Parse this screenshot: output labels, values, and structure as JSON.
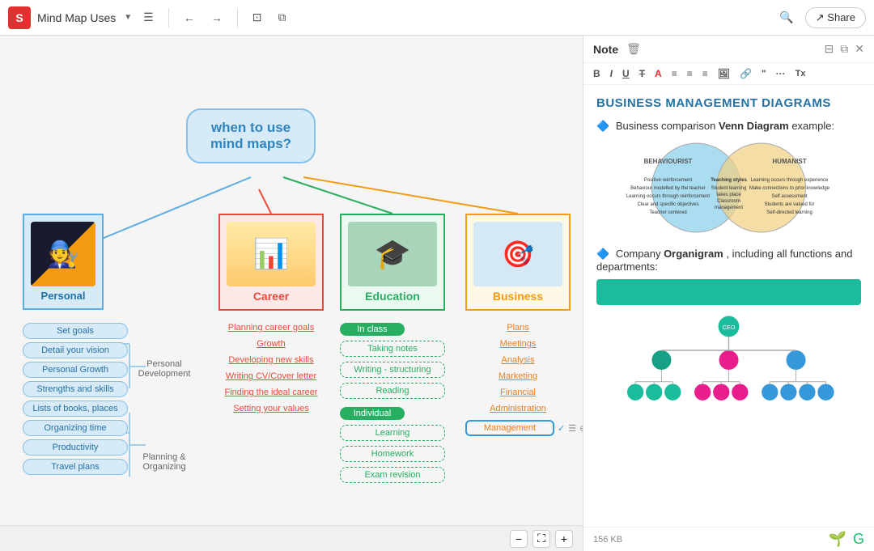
{
  "toolbar": {
    "logo": "S",
    "title": "Mind Map Uses",
    "undo_label": "←",
    "redo_label": "→",
    "search_label": "🔍",
    "share_label": "Share"
  },
  "mindmap": {
    "center_text": "when to use\nmind maps?",
    "personal": {
      "label": "Personal",
      "emoji": "👤",
      "sub_items": [
        "Set goals",
        "Detail your vision",
        "Personal Growth",
        "Strengths and skills",
        "Lists of books, places",
        "Organizing time",
        "Productivity",
        "Travel plans"
      ],
      "group1_label": "Personal\nDevelopment",
      "group2_label": "Planning &\nOrganizing"
    },
    "career": {
      "label": "Career",
      "emoji": "📈",
      "sub_items": [
        "Planning career goals",
        "Growth",
        "Developing new skills",
        "Writing CV/Cover letter",
        "Finding the ideal career",
        "Setting your values"
      ]
    },
    "education": {
      "label": "Education",
      "emoji": "🎓",
      "badge1": "In class",
      "in_class_items": [
        "Taking notes",
        "Writing - structuring",
        "Reading"
      ],
      "badge2": "Individual",
      "individual_items": [
        "Learning",
        "Homework",
        "Exam revision"
      ]
    },
    "business": {
      "label": "Business",
      "emoji": "🎯",
      "sub_items": [
        "Plans",
        "Meetings",
        "Analysis",
        "Marketing",
        "Financial",
        "Administration"
      ],
      "selected_item": "Management"
    }
  },
  "note_panel": {
    "title": "Note",
    "heading": "BUSINESS MANAGEMENT DIAGRAMS",
    "section1_prefix": "Business comparison",
    "section1_bold": " Venn Diagram",
    "section1_suffix": " example:",
    "section2_prefix": "Company ",
    "section2_bold": "Organigram",
    "section2_suffix": ", including all functions and departments:",
    "venn_labels": {
      "left": "BEHAVIOURIST",
      "right": "HUMANIST"
    },
    "footer_size": "156 KB"
  },
  "zoom": {
    "minus": "−",
    "fit": "⛶",
    "plus": "+"
  }
}
